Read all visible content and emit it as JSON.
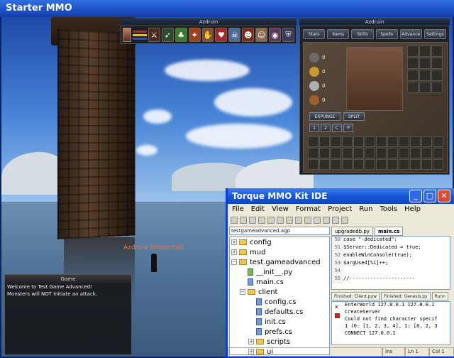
{
  "game": {
    "title": "Starter MMO",
    "player_name": "Azdruin (Immortal)",
    "hud_title": "Azdruin",
    "inventory_title": "Azdruin",
    "inventory_tabs": [
      "Stats",
      "Items",
      "Skills",
      "Spells",
      "Advance",
      "Settings"
    ],
    "coin_counts": [
      "0",
      "0",
      "0",
      "0"
    ],
    "expunge_label": "EXPUNGE",
    "split_label": "SPLIT",
    "split_buttons": [
      "1",
      "2",
      "C",
      "P"
    ],
    "action_icons": [
      "sword-icon",
      "bow-icon",
      "nature-icon",
      "fire-icon",
      "hand-icon",
      "heart-icon",
      "skull-icon",
      "mask-icon",
      "face-icon",
      "eye-icon",
      "shield-icon",
      "axe-icon",
      "claw-icon"
    ],
    "chat": {
      "title": "Game",
      "lines": [
        "Welcome to Test Game Advanced!",
        "Monsters will NOT initiate an attack."
      ]
    }
  },
  "ide": {
    "title": "Torque MMO Kit IDE",
    "menu": [
      "File",
      "Edit",
      "View",
      "Format",
      "Project",
      "Run",
      "Tools",
      "Help"
    ],
    "project_path": "testgameadvanced.agp",
    "tree": [
      {
        "label": "config",
        "type": "folder",
        "indent": 0,
        "expander": "+"
      },
      {
        "label": "mud",
        "type": "folder",
        "indent": 0,
        "expander": "+"
      },
      {
        "label": "test.gameadvanced",
        "type": "folder",
        "indent": 0,
        "expander": "−"
      },
      {
        "label": "__init__.py",
        "type": "py",
        "indent": 1,
        "expander": ""
      },
      {
        "label": "main.cs",
        "type": "file",
        "indent": 1,
        "expander": ""
      },
      {
        "label": "client",
        "type": "folder",
        "indent": 1,
        "expander": "−"
      },
      {
        "label": "config.cs",
        "type": "file",
        "indent": 2,
        "expander": ""
      },
      {
        "label": "defaults.cs",
        "type": "file",
        "indent": 2,
        "expander": ""
      },
      {
        "label": "init.cs",
        "type": "file",
        "indent": 2,
        "expander": ""
      },
      {
        "label": "prefs.cs",
        "type": "file",
        "indent": 2,
        "expander": ""
      },
      {
        "label": "scripts",
        "type": "folder",
        "indent": 2,
        "expander": "+"
      },
      {
        "label": "ui",
        "type": "folder",
        "indent": 2,
        "expander": "+"
      }
    ],
    "editor_tabs": [
      "upgradedb.py",
      "main.cs"
    ],
    "code": [
      {
        "n": "50",
        "text": "   case \"-dedicated\":"
      },
      {
        "n": "51",
        "text": "      $Server::Dedicated = true;"
      },
      {
        "n": "52",
        "text": "      enableWinConsole(true);"
      },
      {
        "n": "53",
        "text": "      $argUsed[%i]++;"
      },
      {
        "n": "54",
        "text": ""
      },
      {
        "n": "55",
        "text": "   //----------------------"
      }
    ],
    "output_tabs": [
      "Finished: Client.pyw",
      "Finished: Genesis.py",
      "Runn"
    ],
    "output": [
      "EnterWorld 127.0.0.1 127.0.0.1",
      "CreateServer",
      "Could not find character specif",
      "1 (0: [1, 2, 3, 4], 1: [0, 2, 3",
      "CONNECT 127.0.0.1"
    ],
    "status": {
      "mode": "Ins",
      "line": "Ln 1",
      "col": "Col 1"
    }
  },
  "colors": {
    "ide_title": "#1857d8",
    "game_title": "#1c4fc4",
    "close_button": "#e0482e"
  }
}
